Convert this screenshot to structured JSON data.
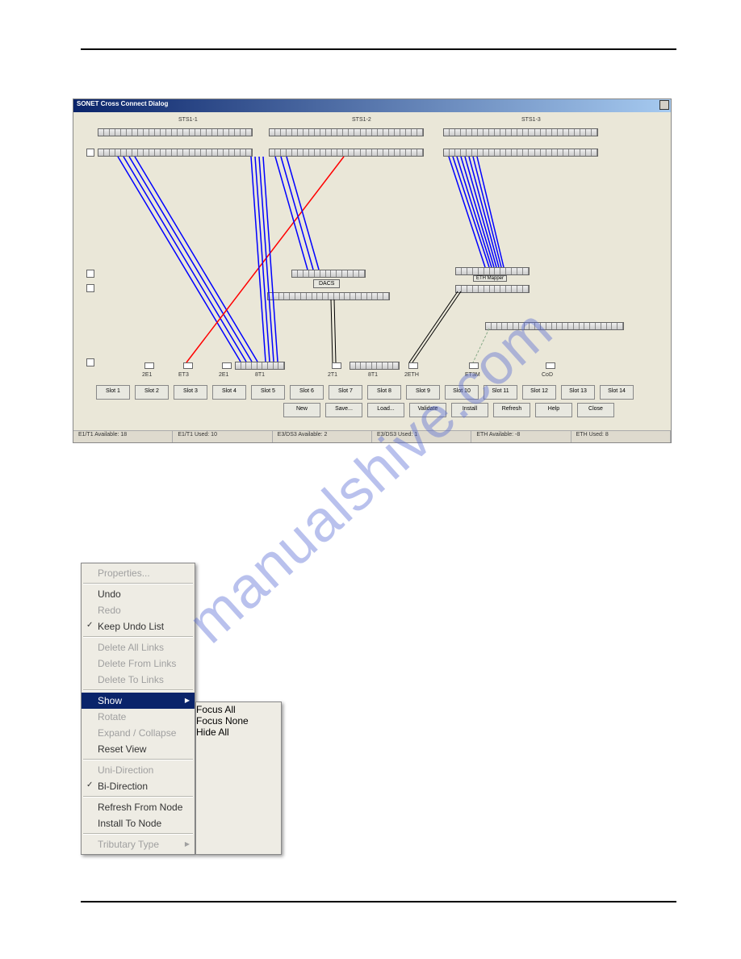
{
  "dialog": {
    "title": "SONET Cross Connect Dialog",
    "sts_labels": [
      "STS1-1",
      "STS1-2",
      "STS1-3"
    ],
    "dacs_label": "DACS",
    "eth_mapper_label": "ETH Mapper",
    "slot_type_labels": [
      "2E1",
      "ET3",
      "2E1",
      "8T1",
      "2T1",
      "8T1",
      "2ETH",
      "ET3M",
      "CoD"
    ],
    "slot_buttons": [
      "Slot 1",
      "Slot 2",
      "Slot 3",
      "Slot 4",
      "Slot 5",
      "Slot 6",
      "Slot 7",
      "Slot 8",
      "Slot 9",
      "Slot 10",
      "Slot 11",
      "Slot 12",
      "Slot 13",
      "Slot 14"
    ],
    "action_buttons": [
      "New",
      "Save...",
      "Load...",
      "Validate",
      "Install",
      "Refresh",
      "Help",
      "Close"
    ],
    "status": {
      "e1t1_avail": "E1/T1 Available: 18",
      "e1t1_used": "E1/T1 Used: 10",
      "e3ds3_avail": "E3/DS3 Available: 2",
      "e3ds3_used": "E3/DS3 Used: 1",
      "eth_avail": "ETH Available: -8",
      "eth_used": "ETH Used: 8"
    }
  },
  "context_menu": {
    "items": [
      {
        "label": "Properties...",
        "disabled": true
      },
      {
        "sep": true
      },
      {
        "label": "Undo"
      },
      {
        "label": "Redo",
        "disabled": true
      },
      {
        "label": "Keep Undo List",
        "checked": true
      },
      {
        "sep": true
      },
      {
        "label": "Delete All Links",
        "disabled": true
      },
      {
        "label": "Delete From Links",
        "disabled": true
      },
      {
        "label": "Delete To Links",
        "disabled": true
      },
      {
        "sep": true
      },
      {
        "label": "Show",
        "hl": true,
        "arrow": true
      },
      {
        "label": "Rotate",
        "disabled": true
      },
      {
        "label": "Expand / Collapse",
        "disabled": true
      },
      {
        "label": "Reset View"
      },
      {
        "sep": true
      },
      {
        "label": "Uni-Direction",
        "disabled": true
      },
      {
        "label": "Bi-Direction",
        "checked": true
      },
      {
        "sep": true
      },
      {
        "label": "Refresh From Node"
      },
      {
        "label": "Install To Node"
      },
      {
        "sep": true
      },
      {
        "label": "Tributary Type",
        "disabled": true,
        "arrow": true
      }
    ],
    "submenu": [
      {
        "label": "Focus All",
        "hl": true
      },
      {
        "label": "Focus None"
      },
      {
        "label": "Hide All"
      }
    ]
  },
  "watermark": "manualshive.com"
}
